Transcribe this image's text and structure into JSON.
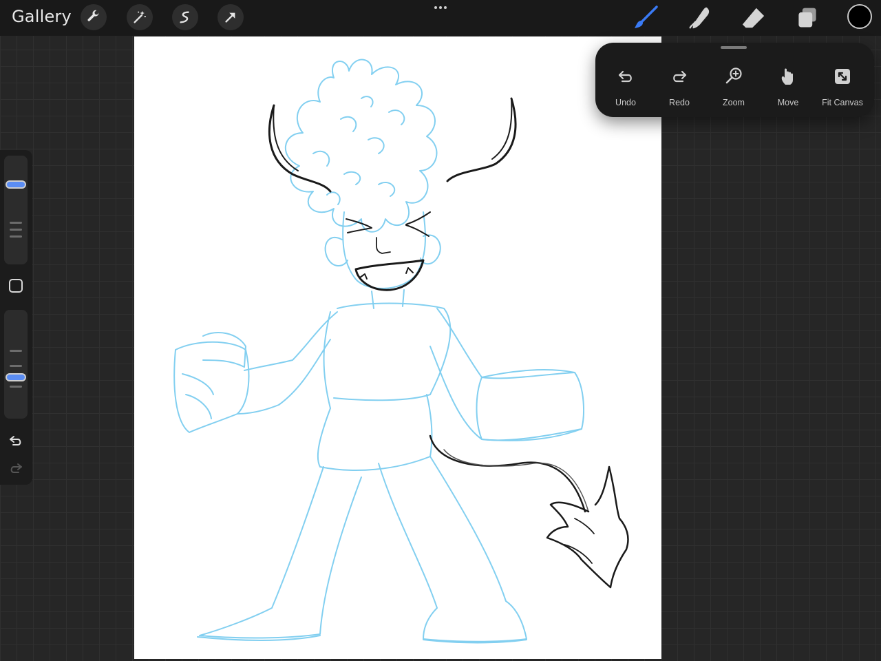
{
  "topbar": {
    "gallery_label": "Gallery",
    "left_tools": [
      "wrench-icon",
      "magic-wand-icon",
      "selection-icon",
      "transform-arrow-icon"
    ],
    "more_icon": "ellipsis-icon",
    "right_tools": [
      "brush-icon",
      "smudge-icon",
      "eraser-icon",
      "layers-icon"
    ],
    "active_tool": "brush",
    "accent_color": "#3a7bf6",
    "current_color": "#000000"
  },
  "gesture_panel": {
    "actions": [
      {
        "label": "Undo",
        "icon": "undo-icon"
      },
      {
        "label": "Redo",
        "icon": "redo-icon"
      },
      {
        "label": "Zoom",
        "icon": "zoom-icon"
      },
      {
        "label": "Move",
        "icon": "hand-icon"
      },
      {
        "label": "Fit Canvas",
        "icon": "fit-canvas-icon"
      }
    ]
  },
  "sidebar": {
    "brush_size_slider": {
      "level": 0.82
    },
    "opacity_slider": {
      "level": 0.4
    },
    "modify_button_icon": "square-icon",
    "undo_icon": "undo-icon",
    "redo_icon": "redo-icon"
  },
  "canvas": {
    "background": "#ffffff",
    "sketch_color": "#7ccdf0",
    "ink_color": "#1a1a1a"
  }
}
